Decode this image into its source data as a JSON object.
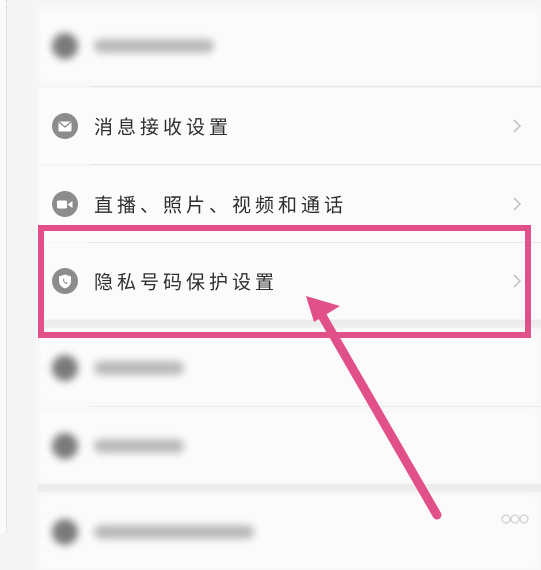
{
  "settings_list": {
    "items": [
      {
        "label": "消息接收设置",
        "icon": "mail-icon"
      },
      {
        "label": "直播、照片、视频和通话",
        "icon": "video-camera-icon"
      },
      {
        "label": "隐私号码保护设置",
        "icon": "shield-phone-icon"
      }
    ]
  },
  "annotation": {
    "highlight_color": "#e2508a",
    "highlighted_item": "隐私号码保护设置"
  },
  "colors": {
    "background": "#f5f5f5",
    "icon_gray": "#8c8c8c",
    "text": "#2e2e2e"
  }
}
